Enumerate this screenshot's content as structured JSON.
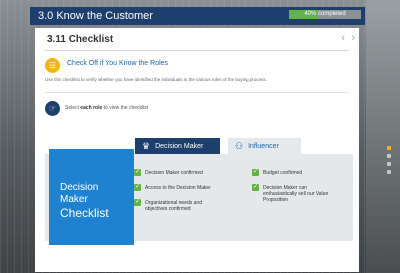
{
  "module": {
    "title": "3.0  Know the Customer",
    "progress_label": "40% completed",
    "progress_value": 0.4
  },
  "section": {
    "title": "3.11 Checklist",
    "prev_icon": "chevron-left-icon",
    "next_icon": "chevron-right-icon"
  },
  "task": {
    "title": "Check Off if You Know the Roles",
    "intro": "Use this checklist to verify whether you have identified the individuals in the various roles of the buying process.",
    "instruction_lead": "Select",
    "instruction_bold": "each role",
    "instruction_tail": "to view the checklist"
  },
  "tabs": [
    {
      "label": "Decision Maker",
      "icon": "person-icon",
      "active": true
    },
    {
      "label": "Influencer",
      "icon": "people-icon",
      "active": false
    }
  ],
  "card": {
    "line1": "Decision",
    "line2": "Maker",
    "line3": "Checklist"
  },
  "checklist": [
    "Decision Maker confirmed",
    "Access to the Decision Maker",
    "Organizational needs and objectives confirmed",
    "Budget confirmed",
    "Decision Maker can enthusiastically sell our Value Proposition"
  ],
  "colors": {
    "header": "#1d3f6d",
    "accent": "#1f82d1",
    "check": "#62b445",
    "highlight": "#f6b21b"
  }
}
